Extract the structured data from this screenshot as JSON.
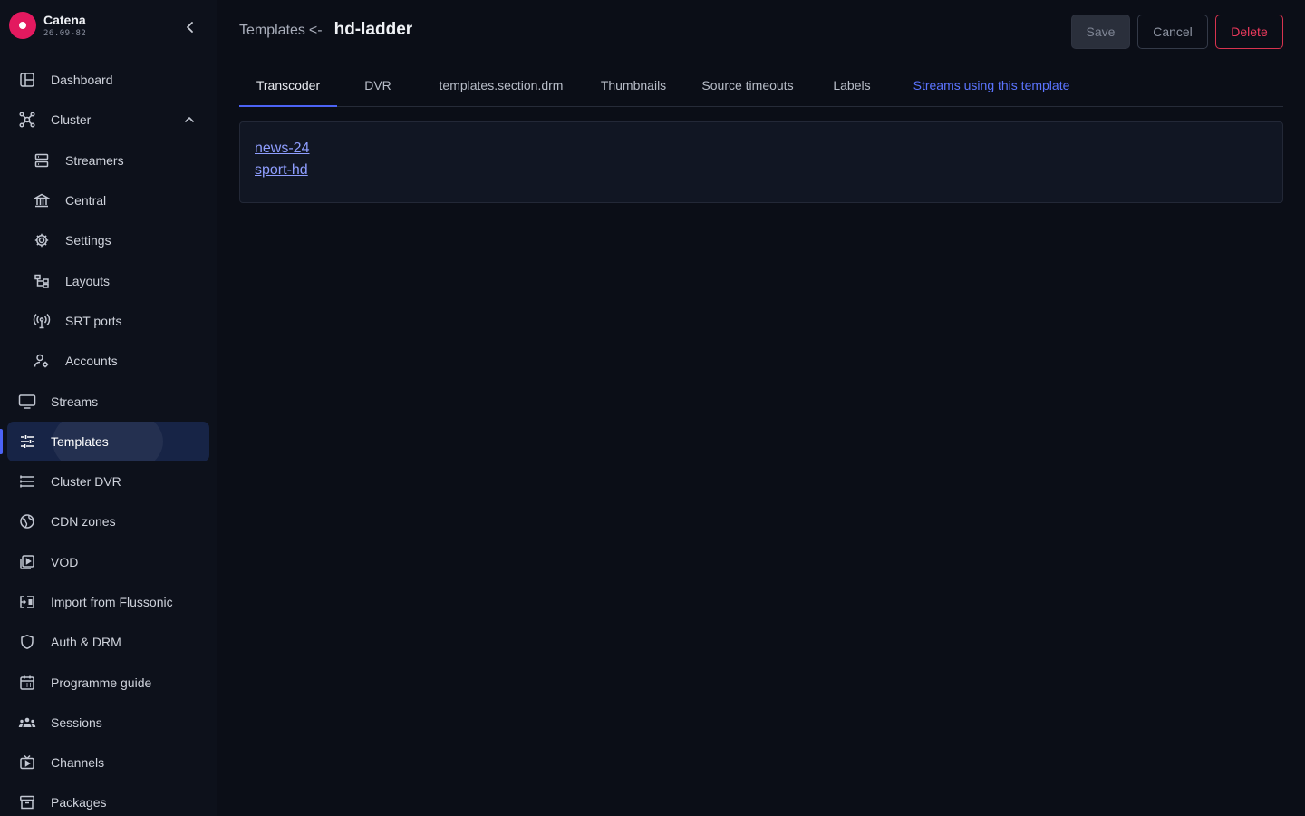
{
  "brand": {
    "name": "Catena",
    "version": "26.09-82"
  },
  "nav": {
    "dashboard": "Dashboard",
    "cluster": "Cluster",
    "streamers": "Streamers",
    "central": "Central",
    "settings": "Settings",
    "layouts": "Layouts",
    "srt_ports": "SRT ports",
    "accounts": "Accounts",
    "streams": "Streams",
    "templates": "Templates",
    "cluster_dvr": "Cluster DVR",
    "cdn_zones": "CDN zones",
    "vod": "VOD",
    "import_flussonic": "Import from Flussonic",
    "auth_drm": "Auth & DRM",
    "programme_guide": "Programme guide",
    "sessions": "Sessions",
    "channels": "Channels",
    "packages": "Packages"
  },
  "header": {
    "breadcrumb_parent": "Templates",
    "breadcrumb_sep": "<-",
    "title": "hd-ladder"
  },
  "actions": {
    "save": "Save",
    "cancel": "Cancel",
    "delete": "Delete"
  },
  "tabs": {
    "transcoder": "Transcoder",
    "dvr": "DVR",
    "drm": "templates.section.drm",
    "thumbnails": "Thumbnails",
    "source_timeouts": "Source timeouts",
    "labels": "Labels",
    "streams_using": "Streams using this template"
  },
  "streams": [
    "news-24",
    "sport-hd"
  ],
  "colors": {
    "accent": "#4c63f5",
    "link": "#8f9eff",
    "danger": "#ef3a5d",
    "brand": "#e3195f"
  }
}
